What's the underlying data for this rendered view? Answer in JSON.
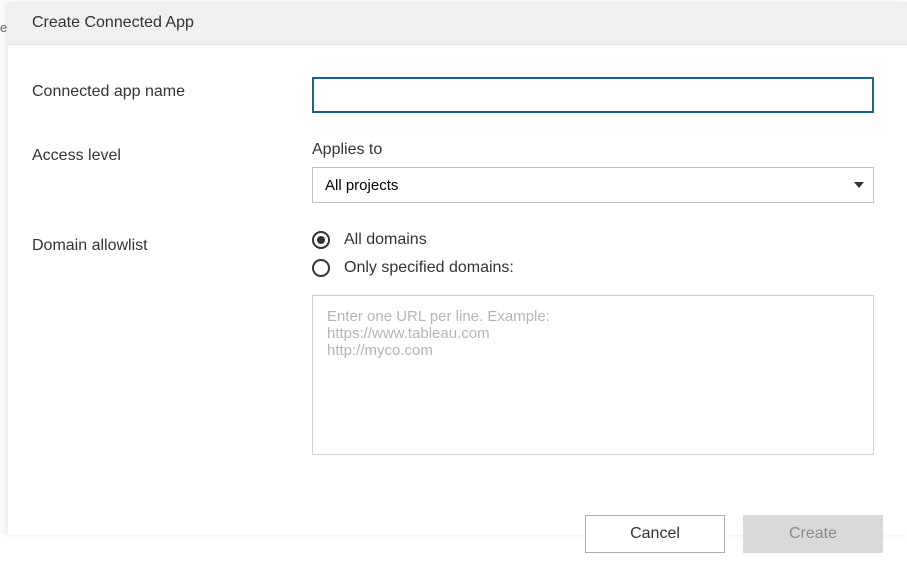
{
  "background_sliver_text": "e",
  "dialog": {
    "title": "Create Connected App"
  },
  "form": {
    "name": {
      "label": "Connected app name",
      "value": ""
    },
    "access": {
      "label": "Access level",
      "sublabel": "Applies to",
      "selected": "All projects"
    },
    "domain": {
      "label": "Domain allowlist",
      "options": {
        "all": "All domains",
        "only": "Only specified domains:"
      },
      "selected": "all",
      "textarea_value": "",
      "textarea_placeholder": "Enter one URL per line. Example:\nhttps://www.tableau.com\nhttp://myco.com"
    }
  },
  "buttons": {
    "cancel": "Cancel",
    "create": "Create"
  }
}
